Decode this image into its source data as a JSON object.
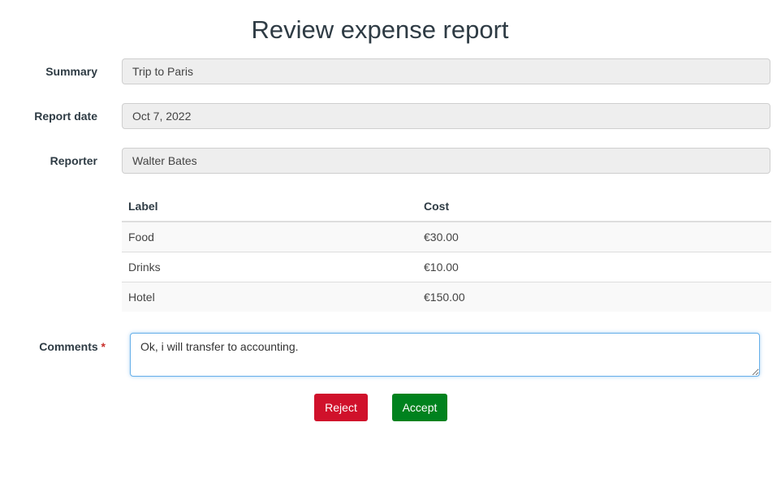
{
  "page": {
    "title": "Review expense report"
  },
  "fields": {
    "summary": {
      "label": "Summary",
      "value": "Trip to Paris"
    },
    "report_date": {
      "label": "Report date",
      "value": "Oct 7, 2022"
    },
    "reporter": {
      "label": "Reporter",
      "value": "Walter Bates"
    }
  },
  "expenses": {
    "headers": {
      "label": "Label",
      "cost": "Cost"
    },
    "rows": [
      {
        "label": "Food",
        "cost": "€30.00"
      },
      {
        "label": "Drinks",
        "cost": "€10.00"
      },
      {
        "label": "Hotel",
        "cost": "€150.00"
      }
    ]
  },
  "comments": {
    "label": "Comments",
    "required_mark": "*",
    "value": "Ok, i will transfer to accounting."
  },
  "actions": {
    "reject_label": "Reject",
    "accept_label": "Accept"
  },
  "colors": {
    "reject": "#d0112b",
    "accept": "#00821e",
    "focus_border": "#66afe9"
  }
}
